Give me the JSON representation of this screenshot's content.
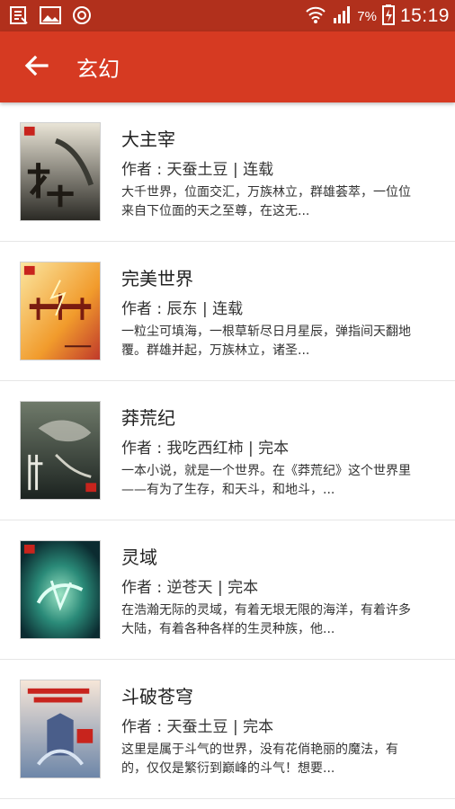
{
  "status_bar": {
    "time": "15:19",
    "battery_percent": "7%",
    "icons": [
      "notification-book-icon",
      "image-icon",
      "record-icon",
      "wifi-icon",
      "signal-icon",
      "battery-icon"
    ]
  },
  "app_bar": {
    "title": "玄幻",
    "back_icon": "back-arrow-icon",
    "color": "#d63a22"
  },
  "books": [
    {
      "title": "大主宰",
      "meta": "作者 : 天蚕土豆 | 连载",
      "description": "大千世界，位面交汇，万族林立，群雄荟萃，一位位来自下位面的天之至尊，在这无..."
    },
    {
      "title": "完美世界",
      "meta": "作者 : 辰东 | 连载",
      "description": "一粒尘可填海，一根草斩尽日月星辰，弹指间天翻地覆。群雄并起，万族林立，诸圣..."
    },
    {
      "title": "莽荒纪",
      "meta": "作者 : 我吃西红柿 | 完本",
      "description": "一本小说，就是一个世界。在《莽荒纪》这个世界里——有为了生存，和天斗，和地斗，..."
    },
    {
      "title": "灵域",
      "meta": "作者 : 逆苍天 | 完本",
      "description": "在浩瀚无际的灵域，有着无垠无限的海洋，有着许多大陆，有着各种各样的生灵种族，他..."
    },
    {
      "title": "斗破苍穹",
      "meta": "作者 : 天蚕土豆 | 完本",
      "description": "这里是属于斗气的世界，没有花俏艳丽的魔法，有的，仅仅是繁衍到巅峰的斗气！想要..."
    }
  ]
}
